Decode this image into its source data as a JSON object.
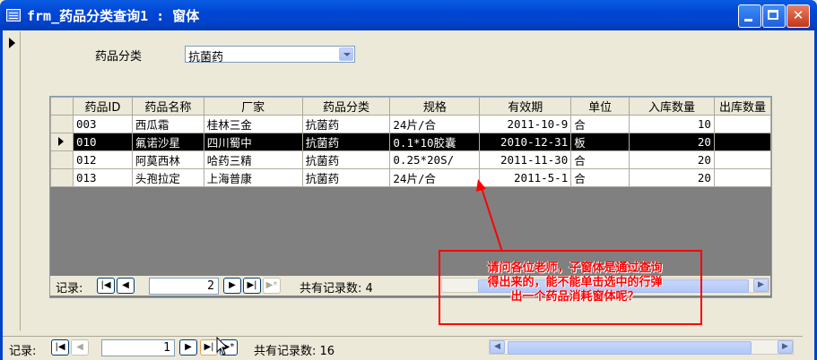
{
  "window": {
    "title": "frm_药品分类查询1 : 窗体",
    "minimize_label": "",
    "maximize_label": "",
    "close_label": "✕"
  },
  "filter": {
    "label": "药品分类",
    "value": "抗菌药"
  },
  "subform": {
    "columns": [
      "药品ID",
      "药品名称",
      "厂家",
      "药品分类",
      "规格",
      "有效期",
      "单位",
      "入库数量",
      "出库数量"
    ],
    "rows": [
      {
        "id": "003",
        "name": "西瓜霜",
        "maker": "桂林三金",
        "category": "抗菌药",
        "spec": "24片/合",
        "expiry": "2011-10-9",
        "unit": "合",
        "stock_in": "10",
        "stock_out": ""
      },
      {
        "id": "010",
        "name": "氟诺沙星",
        "maker": "四川蜀中",
        "category": "抗菌药",
        "spec": "0.1*10胶囊",
        "expiry": "2010-12-31",
        "unit": "板",
        "stock_in": "20",
        "stock_out": ""
      },
      {
        "id": "012",
        "name": "阿莫西林",
        "maker": "哈药三精",
        "category": "抗菌药",
        "spec": "0.25*20S/",
        "expiry": "2011-11-30",
        "unit": "合",
        "stock_in": "20",
        "stock_out": ""
      },
      {
        "id": "013",
        "name": "头孢拉定",
        "maker": "上海普康",
        "category": "抗菌药",
        "spec": "24片/合",
        "expiry": "2011-5-1",
        "unit": "合",
        "stock_in": "20",
        "stock_out": ""
      }
    ],
    "current_row_index": 1,
    "nav": {
      "label": "记录:",
      "current": "2",
      "total_text": "共有记录数: 4"
    }
  },
  "main_nav": {
    "label": "记录:",
    "current": "1",
    "total_text": "共有记录数: 16"
  },
  "annotation": {
    "text": "请问各位老师，子窗体是通过查询得出来的，能不能单击选中的行弹出一个药品消耗窗体呢？",
    "color": "#ff0000"
  },
  "colors": {
    "titlebar": "#0046d5",
    "selected_row": "#000000",
    "subform_background": "#808080"
  }
}
